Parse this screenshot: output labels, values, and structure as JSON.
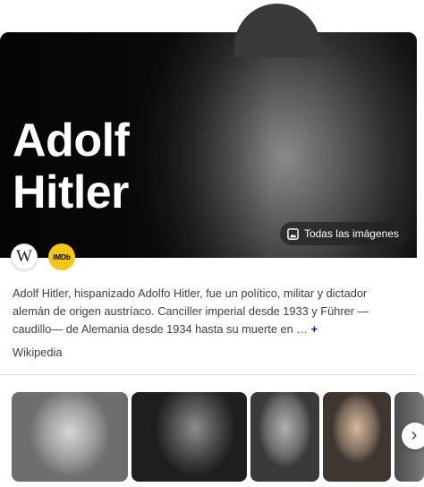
{
  "hero": {
    "title_line1": "Adolf",
    "title_line2": "Hitler",
    "all_images_label": "Todas las imágenes"
  },
  "sources": [
    {
      "icon": "wikipedia-icon",
      "glyph": "W"
    },
    {
      "icon": "imdb-icon",
      "glyph": "IMDb"
    }
  ],
  "description": {
    "text": "Adolf Hitler, hispanizado Adolfo Hitler, fue un político, militar y dictador alemán de origen austríaco. Canciller imperial desde 1933 y Führer — caudillo— de Alemania desde 1934 hasta su muerte en … ",
    "more_glyph": "+",
    "source": "Wikipedia"
  },
  "image_strip": {
    "thumbnail_count": 5,
    "next_glyph": "›"
  },
  "colors": {
    "accent_link": "#1a0dab",
    "imdb_yellow": "#f5c518",
    "text": "#3c4043"
  }
}
